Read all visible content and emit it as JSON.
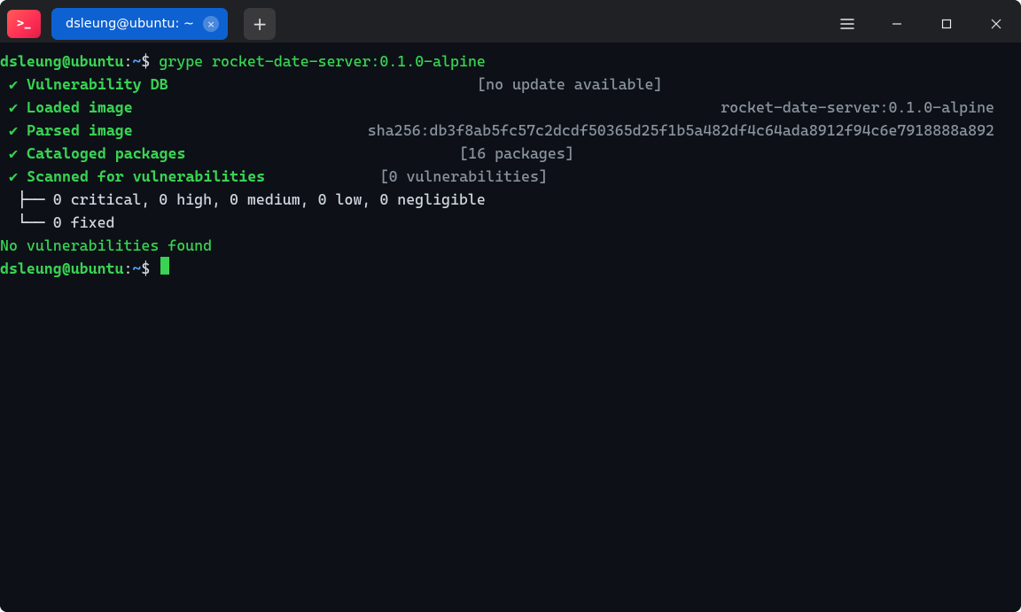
{
  "titlebar": {
    "app_icon_glyph": ">_",
    "tab_title": "dsleung@ubuntu: ~",
    "tab_close_glyph": "×",
    "newtab_glyph": "+"
  },
  "prompt1": {
    "user_host": "dsleung@ubuntu",
    "sep1": ":",
    "cwd": "~",
    "sep2": "$",
    "command": " grype rocket-date-server:0.1.0-alpine"
  },
  "status": [
    {
      "check": "✔",
      "label": "Vulnerability DB",
      "info_left": "[no update available]",
      "info_right": ""
    },
    {
      "check": "✔",
      "label": "Loaded image",
      "info_left": "",
      "info_right": "rocket-date-server:0.1.0-alpine"
    },
    {
      "check": "✔",
      "label": "Parsed image",
      "info_left": "",
      "info_right": "sha256:db3f8ab5fc57c2dcdf50365d25f1b5a482df4c64ada8912f94c6e7918888a892"
    },
    {
      "check": "✔",
      "label": "Cataloged packages",
      "info_left": "[16 packages]",
      "info_right": ""
    },
    {
      "check": "✔",
      "label": "Scanned for vulnerabilities",
      "info_left": "[0 vulnerabilities]",
      "info_right": ""
    }
  ],
  "tree": {
    "line1": "  ├── 0 critical, 0 high, 0 medium, 0 low, 0 negligible",
    "line2": "  └── 0 fixed"
  },
  "result_line": "No vulnerabilities found",
  "prompt2": {
    "user_host": "dsleung@ubuntu",
    "sep1": ":",
    "cwd": "~",
    "sep2": "$"
  },
  "label_pad": 30,
  "left_col_width": 40
}
